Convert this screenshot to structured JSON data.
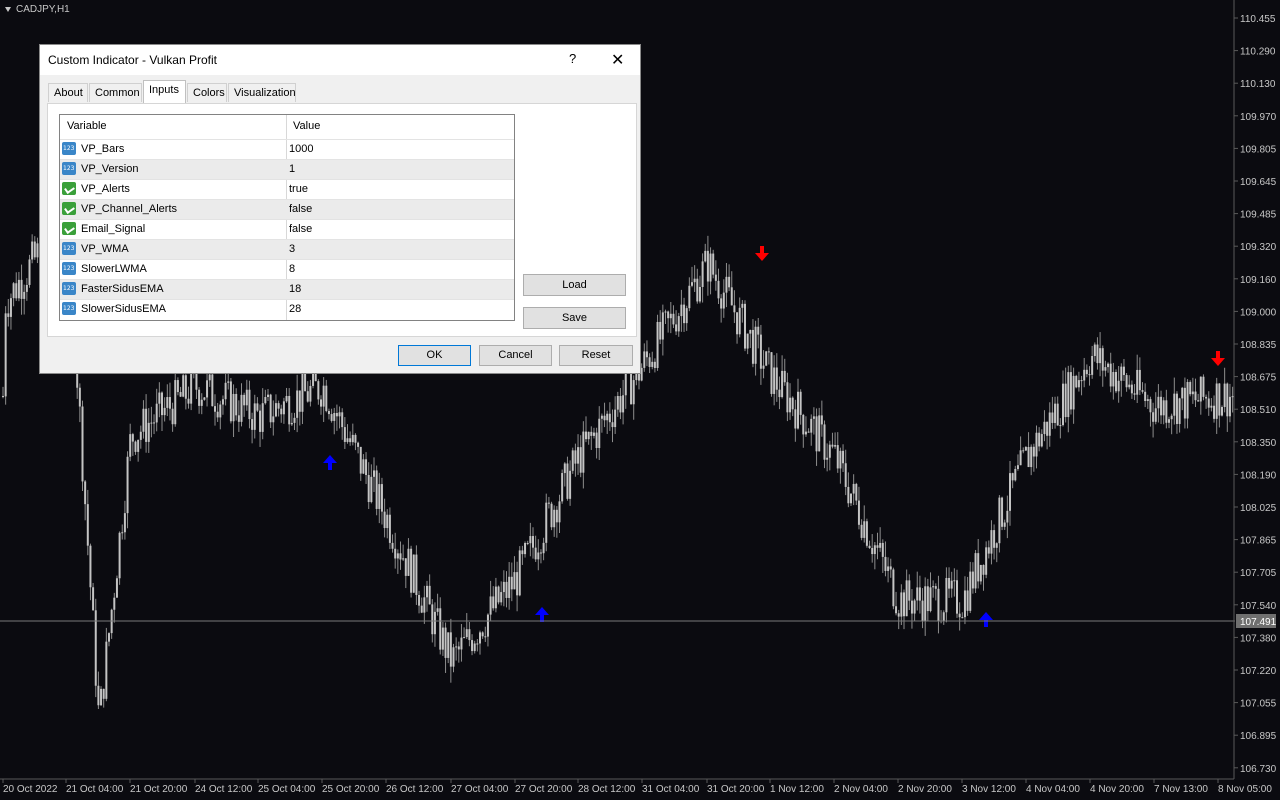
{
  "chart": {
    "symbol": "CADJPY,H1",
    "colors": {
      "background": "#0b0b10",
      "candle": "#c4c4c4",
      "axis_text": "#c8c8c8",
      "buy_arrow": "#0000ff",
      "sell_arrow": "#ff0000"
    },
    "price_labels": [
      "110.455",
      "110.290",
      "110.130",
      "109.970",
      "109.805",
      "109.645",
      "109.485",
      "109.320",
      "109.160",
      "109.000",
      "108.835",
      "108.675",
      "108.510",
      "108.350",
      "108.190",
      "108.025",
      "107.865",
      "107.705",
      "107.540",
      "107.380",
      "107.220",
      "107.055",
      "106.895",
      "106.730"
    ],
    "current_price": "107.491",
    "time_labels": [
      "20 Oct 2022",
      "21 Oct 04:00",
      "21 Oct 20:00",
      "24 Oct 12:00",
      "25 Oct 04:00",
      "25 Oct 20:00",
      "26 Oct 12:00",
      "27 Oct 04:00",
      "27 Oct 20:00",
      "28 Oct 12:00",
      "31 Oct 04:00",
      "31 Oct 20:00",
      "1 Nov 12:00",
      "2 Nov 04:00",
      "2 Nov 20:00",
      "3 Nov 12:00",
      "4 Nov 04:00",
      "4 Nov 20:00",
      "7 Nov 13:00",
      "8 Nov 05:00"
    ]
  },
  "chart_data": {
    "type": "candlestick",
    "y_range": [
      106.73,
      110.455
    ],
    "close_path": [
      [
        "20 Oct 2022",
        109.05
      ],
      [
        "21 Oct 04:00",
        109.5
      ],
      [
        "21 Oct 12:00",
        107.0
      ],
      [
        "21 Oct 20:00",
        108.4
      ],
      [
        "24 Oct 12:00",
        108.65
      ],
      [
        "25 Oct 04:00",
        108.5
      ],
      [
        "25 Oct 20:00",
        108.65
      ],
      [
        "26 Oct 12:00",
        108.0
      ],
      [
        "27 Oct 04:00",
        107.3
      ],
      [
        "27 Oct 20:00",
        107.7
      ],
      [
        "28 Oct 12:00",
        108.3
      ],
      [
        "31 Oct 04:00",
        108.75
      ],
      [
        "31 Oct 20:00",
        109.25
      ],
      [
        "1 Nov 12:00",
        108.7
      ],
      [
        "2 Nov 04:00",
        108.3
      ],
      [
        "2 Nov 20:00",
        107.6
      ],
      [
        "3 Nov 12:00",
        107.6
      ],
      [
        "4 Nov 04:00",
        108.3
      ],
      [
        "4 Nov 20:00",
        108.8
      ],
      [
        "7 Nov 13:00",
        108.55
      ],
      [
        "8 Nov 05:00",
        108.6
      ]
    ],
    "signals": [
      {
        "type": "buy",
        "time": "25 Oct 04:00"
      },
      {
        "type": "buy",
        "time": "27 Oct 20:00"
      },
      {
        "type": "sell",
        "time": "31 Oct 20:00"
      },
      {
        "type": "buy",
        "time": "3 Nov 12:00"
      },
      {
        "type": "sell",
        "time": "8 Nov 05:00"
      }
    ]
  },
  "dialog": {
    "title": "Custom Indicator - Vulkan Profit",
    "help": "?",
    "close": "✕",
    "tabs": [
      "About",
      "Common",
      "Inputs",
      "Colors",
      "Visualization"
    ],
    "active_tab": "Inputs",
    "columns": {
      "variable": "Variable",
      "value": "Value"
    },
    "params": [
      {
        "name": "VP_Bars",
        "value": "1000",
        "icon": "number-icon"
      },
      {
        "name": "VP_Version",
        "value": "1",
        "icon": "number-icon"
      },
      {
        "name": "VP_Alerts",
        "value": "true",
        "icon": "bool-icon"
      },
      {
        "name": "VP_Channel_Alerts",
        "value": "false",
        "icon": "bool-icon"
      },
      {
        "name": "Email_Signal",
        "value": "false",
        "icon": "bool-icon"
      },
      {
        "name": "VP_WMA",
        "value": "3",
        "icon": "number-icon"
      },
      {
        "name": "SlowerLWMA",
        "value": "8",
        "icon": "number-icon"
      },
      {
        "name": "FasterSidusEMA",
        "value": "18",
        "icon": "number-icon"
      },
      {
        "name": "SlowerSidusEMA",
        "value": "28",
        "icon": "number-icon"
      }
    ],
    "buttons": {
      "load": "Load",
      "save": "Save",
      "ok": "OK",
      "cancel": "Cancel",
      "reset": "Reset"
    }
  }
}
